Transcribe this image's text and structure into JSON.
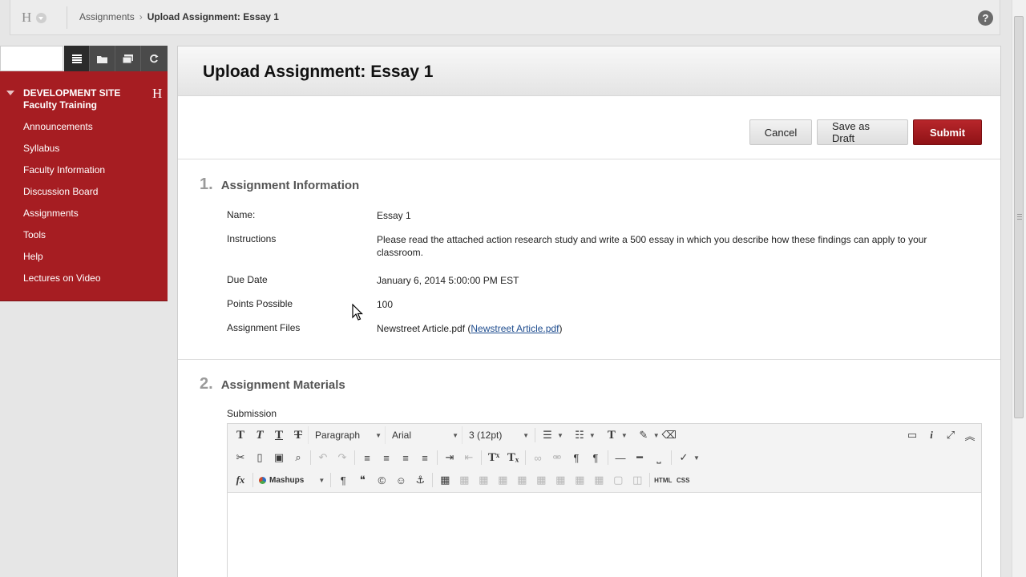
{
  "breadcrumb": {
    "items": [
      "Assignments",
      "Upload Assignment: Essay 1"
    ]
  },
  "header": {
    "home_glyph": "H",
    "help_glyph": "?"
  },
  "course_menu": {
    "title": "DEVELOPMENT SITE Faculty Training",
    "title_glyph": "H",
    "items": [
      "Announcements",
      "Syllabus",
      "Faculty Information",
      "Discussion Board",
      "Assignments",
      "Tools",
      "Help",
      "Lectures on Video"
    ]
  },
  "page": {
    "title": "Upload Assignment: Essay 1",
    "buttons": {
      "cancel": "Cancel",
      "save_draft": "Save as Draft",
      "submit": "Submit"
    }
  },
  "section1": {
    "number": "1.",
    "title": "Assignment Information",
    "fields": {
      "name_label": "Name:",
      "name_value": "Essay 1",
      "instructions_label": "Instructions",
      "instructions_value": "Please read the attached action research study and write a 500 essay in which you describe how these findings can apply to your classroom.",
      "due_label": "Due Date",
      "due_value": "January 6, 2014 5:00:00 PM EST",
      "points_label": "Points Possible",
      "points_value": "100",
      "files_label": "Assignment Files",
      "file_name": "Newstreet Article.pdf",
      "file_link": "Newstreet Article.pdf"
    }
  },
  "section2": {
    "number": "2.",
    "title": "Assignment Materials",
    "submission_label": "Submission"
  },
  "editor": {
    "format_block": "Paragraph",
    "font_family": "Arial",
    "font_size": "3 (12pt)",
    "mashups": "Mashups",
    "html_label": "HTML",
    "css_label": "CSS"
  }
}
